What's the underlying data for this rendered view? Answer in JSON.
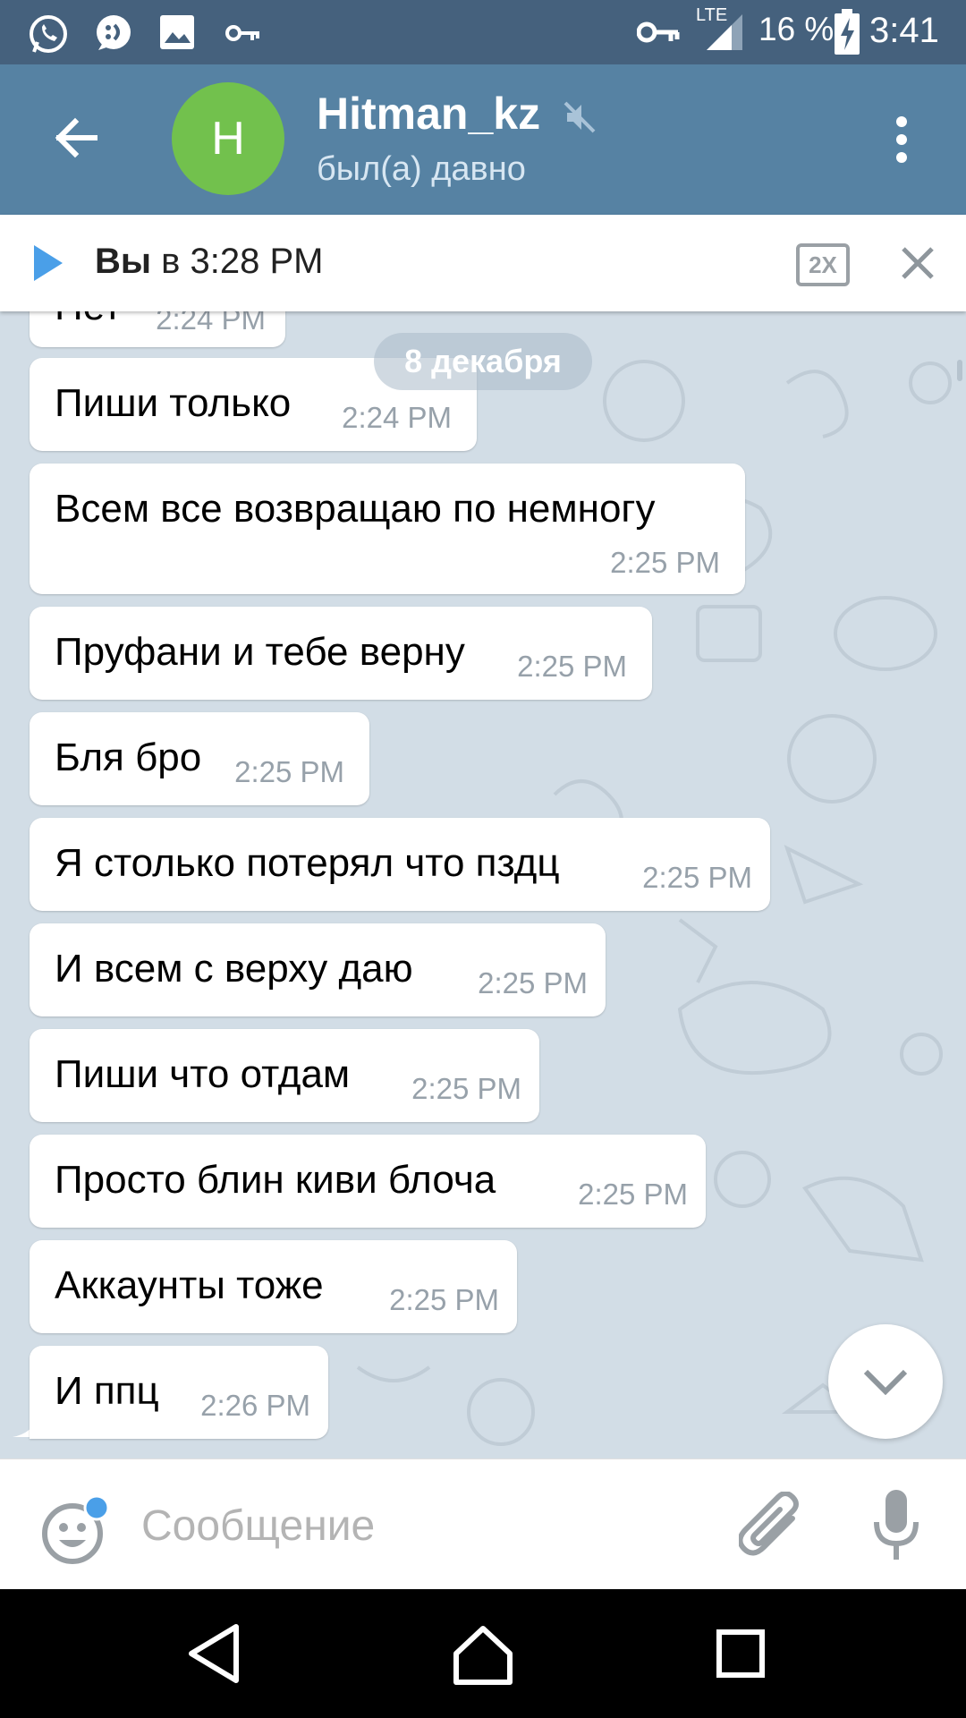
{
  "status_bar": {
    "network": "LTE",
    "battery": "16 %",
    "time": "3:41",
    "left_icons": [
      "whatsapp-icon",
      "chat-bubble-icon",
      "gallery-icon",
      "key-icon"
    ],
    "right_icons": [
      "vpn-key-icon",
      "signal-icon",
      "battery-charging-icon"
    ]
  },
  "header": {
    "avatar_letter": "H",
    "avatar_color": "#72c14d",
    "title": "Hitman_kz",
    "muted_icon": "muted-icon",
    "subtitle": "был(а) давно"
  },
  "player": {
    "sender": "Вы",
    "time_text": " в 3:28 PM",
    "speed_label": "2X"
  },
  "date_chip": "8 декабря",
  "partial_message": {
    "text": "Нет",
    "time": "2:24 PM"
  },
  "messages": [
    {
      "text": "Пиши только",
      "time": "2:24 PM"
    },
    {
      "text": "Всем все возвращаю по немногу",
      "time": "2:25 PM"
    },
    {
      "text": "Пруфани и тебе верну",
      "time": "2:25 PM"
    },
    {
      "text": "Бля бро",
      "time": "2:25 PM"
    },
    {
      "text": "Я столько потерял что пздц",
      "time": "2:25 PM"
    },
    {
      "text": "И всем с верху даю",
      "time": "2:25 PM"
    },
    {
      "text": "Пиши что отдам",
      "time": "2:25 PM"
    },
    {
      "text": "Просто блин киви блоча",
      "time": "2:25 PM"
    },
    {
      "text": "Аккаунты тоже",
      "time": "2:25 PM"
    },
    {
      "text": "И ппц",
      "time": "2:26 PM"
    }
  ],
  "input": {
    "placeholder": "Сообщение"
  },
  "colors": {
    "status_bar": "#45617d",
    "header": "#5682a3",
    "chat_background": "#d2dde6",
    "accent": "#4a9fe8"
  }
}
